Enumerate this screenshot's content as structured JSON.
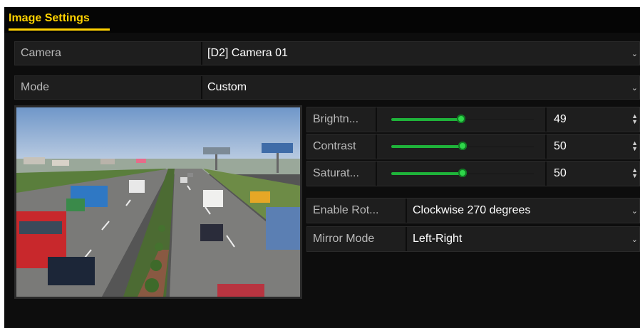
{
  "panel": {
    "title": "Image Settings"
  },
  "fields": {
    "camera": {
      "label": "Camera",
      "value": "[D2] Camera 01",
      "icon": "chevron-down-icon"
    },
    "mode": {
      "label": "Mode",
      "value": "Custom",
      "icon": "chevron-down-icon"
    }
  },
  "adjustments": [
    {
      "label": "Brightn...",
      "value": "49",
      "level_percent": 49
    },
    {
      "label": "Contrast",
      "value": "50",
      "level_percent": 50
    },
    {
      "label": "Saturat...",
      "value": "50",
      "level_percent": 50
    }
  ],
  "options": {
    "rotation": {
      "label": "Enable Rot...",
      "value": "Clockwise 270 degrees"
    },
    "mirror": {
      "label": "Mirror Mode",
      "value": "Left-Right"
    }
  },
  "colors": {
    "accent": "#ffd200",
    "slider": "#1fb33a",
    "background": "#0d0d0d",
    "row": "#1e1e1e"
  }
}
